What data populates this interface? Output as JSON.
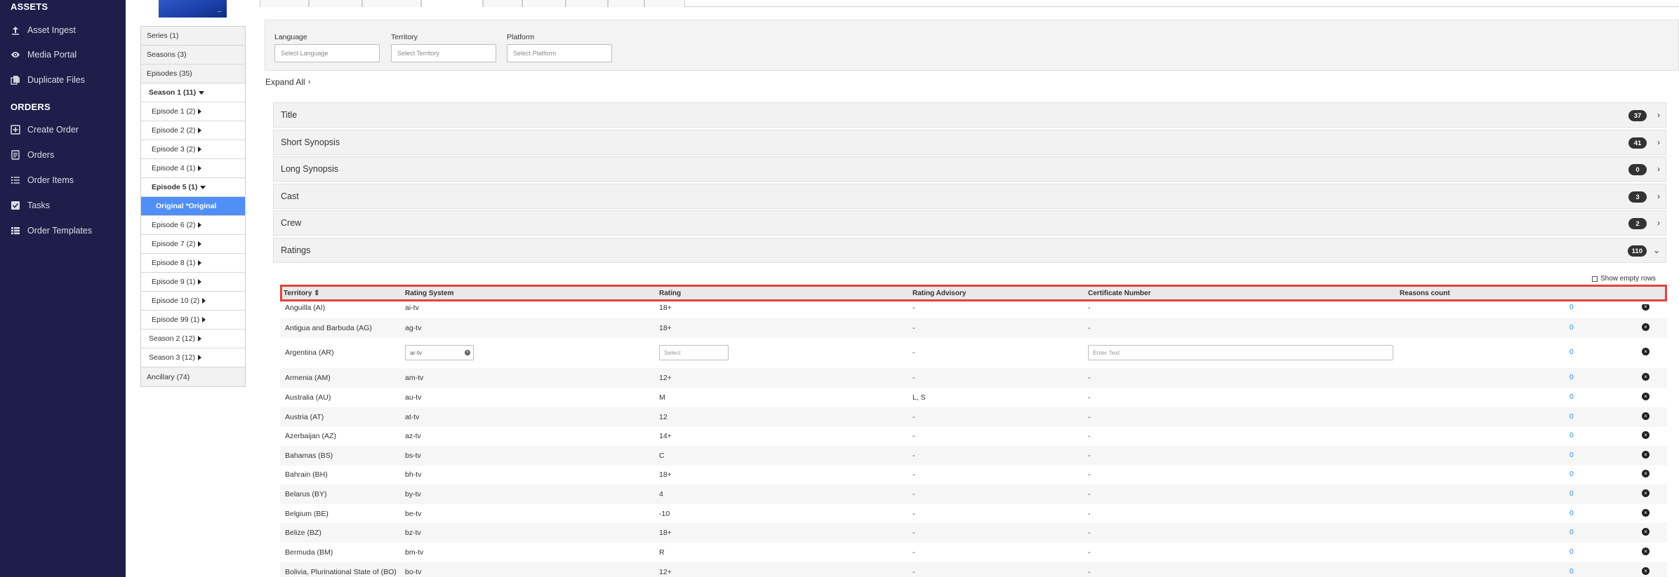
{
  "sidebar": {
    "assets_heading": "ASSETS",
    "assets_items": [
      {
        "label": "Asset Ingest",
        "icon": "upload-icon"
      },
      {
        "label": "Media Portal",
        "icon": "eye-icon"
      },
      {
        "label": "Duplicate Files",
        "icon": "files-icon"
      }
    ],
    "orders_heading": "ORDERS",
    "orders_items": [
      {
        "label": "Create Order",
        "icon": "plus-square-icon"
      },
      {
        "label": "Orders",
        "icon": "document-icon"
      },
      {
        "label": "Order Items",
        "icon": "list-icon"
      },
      {
        "label": "Tasks",
        "icon": "checkbox-icon"
      },
      {
        "label": "Order Templates",
        "icon": "table-icon"
      }
    ]
  },
  "thumbnail": {
    "tag": "←"
  },
  "tree": [
    {
      "label": "Series (1)",
      "level": 0,
      "caret": ""
    },
    {
      "label": "Seasons (3)",
      "level": 0,
      "caret": ""
    },
    {
      "label": "Episodes (35)",
      "level": 0,
      "caret": ""
    },
    {
      "label": "Season 1 (11)",
      "level": 1,
      "caret": "down",
      "bold": true
    },
    {
      "label": "Episode 1 (2)",
      "level": 2,
      "caret": "right"
    },
    {
      "label": "Episode 2 (2)",
      "level": 2,
      "caret": "right"
    },
    {
      "label": "Episode 3 (2)",
      "level": 2,
      "caret": "right"
    },
    {
      "label": "Episode 4 (1)",
      "level": 2,
      "caret": "right"
    },
    {
      "label": "Episode 5 (1)",
      "level": 2,
      "caret": "down",
      "bold": true
    },
    {
      "label": "Original *Original",
      "level": 3,
      "caret": ""
    },
    {
      "label": "Episode 6 (2)",
      "level": 2,
      "caret": "right"
    },
    {
      "label": "Episode 7 (2)",
      "level": 2,
      "caret": "right"
    },
    {
      "label": "Episode 8 (1)",
      "level": 2,
      "caret": "right"
    },
    {
      "label": "Episode 9 (1)",
      "level": 2,
      "caret": "right"
    },
    {
      "label": "Episode 10 (2)",
      "level": 2,
      "caret": "right"
    },
    {
      "label": "Episode 99 (1)",
      "level": 2,
      "caret": "right"
    },
    {
      "label": "Season 2 (12)",
      "level": 1,
      "caret": "right"
    },
    {
      "label": "Season 3 (12)",
      "level": 1,
      "caret": "right"
    },
    {
      "label": "Ancillary (74)",
      "level": 0,
      "caret": ""
    }
  ],
  "filters": {
    "language": {
      "label": "Language",
      "placeholder": "Select Language"
    },
    "territory": {
      "label": "Territory",
      "placeholder": "Select Territory"
    },
    "platform": {
      "label": "Platform",
      "placeholder": "Select Platform"
    }
  },
  "expand_all": "Expand All",
  "sections": [
    {
      "label": "Title",
      "count": "37",
      "chevron": "›"
    },
    {
      "label": "Short Synopsis",
      "count": "41",
      "chevron": "›"
    },
    {
      "label": "Long Synopsis",
      "count": "0",
      "chevron": "›"
    },
    {
      "label": "Cast",
      "count": "3",
      "chevron": "›"
    },
    {
      "label": "Crew",
      "count": "2",
      "chevron": "›"
    },
    {
      "label": "Ratings",
      "count": "110",
      "chevron": "⌄"
    }
  ],
  "show_empty_rows": "Show empty rows",
  "ratings_table": {
    "headers": [
      "Territory ⇕",
      "Rating System",
      "Rating",
      "Rating Advisory",
      "Certificate Number",
      "Reasons count"
    ],
    "rows": [
      {
        "territory": "Anguilla (AI)",
        "system": "ai-tv",
        "rating": "18+",
        "advisory": "-",
        "certificate": "-",
        "count": "0"
      },
      {
        "territory": "Antigua and Barbuda (AG)",
        "system": "ag-tv",
        "rating": "18+",
        "advisory": "-",
        "certificate": "-",
        "count": "0"
      },
      {
        "territory": "Argentina (AR)",
        "system": "ar-tv",
        "rating": "",
        "rating_placeholder": "Select",
        "advisory": "-",
        "certificate": "",
        "certificate_placeholder": "Enter Text",
        "count": "0",
        "editing": true
      },
      {
        "territory": "Armenia (AM)",
        "system": "am-tv",
        "rating": "12+",
        "advisory": "-",
        "certificate": "-",
        "count": "0"
      },
      {
        "territory": "Australia (AU)",
        "system": "au-tv",
        "rating": "M",
        "advisory": "L, S",
        "certificate": "-",
        "count": "0"
      },
      {
        "territory": "Austria (AT)",
        "system": "at-tv",
        "rating": "12",
        "advisory": "-",
        "certificate": "-",
        "count": "0"
      },
      {
        "territory": "Azerbaijan (AZ)",
        "system": "az-tv",
        "rating": "14+",
        "advisory": "-",
        "certificate": "-",
        "count": "0"
      },
      {
        "territory": "Bahamas (BS)",
        "system": "bs-tv",
        "rating": "C",
        "advisory": "-",
        "certificate": "-",
        "count": "0"
      },
      {
        "territory": "Bahrain (BH)",
        "system": "bh-tv",
        "rating": "18+",
        "advisory": "-",
        "certificate": "-",
        "count": "0"
      },
      {
        "territory": "Belarus (BY)",
        "system": "by-tv",
        "rating": "4",
        "advisory": "-",
        "certificate": "-",
        "count": "0"
      },
      {
        "territory": "Belgium (BE)",
        "system": "be-tv",
        "rating": "-10",
        "advisory": "-",
        "certificate": "-",
        "count": "0"
      },
      {
        "territory": "Belize (BZ)",
        "system": "bz-tv",
        "rating": "18+",
        "advisory": "-",
        "certificate": "-",
        "count": "0"
      },
      {
        "territory": "Bermuda (BM)",
        "system": "bm-tv",
        "rating": "R",
        "advisory": "-",
        "certificate": "-",
        "count": "0"
      },
      {
        "territory": "Bolivia, Plurinational State of (BO)",
        "system": "bo-tv",
        "rating": "12+",
        "advisory": "-",
        "certificate": "-",
        "count": "0"
      }
    ]
  },
  "colors": {
    "sidebar_bg": "#1f1e4a",
    "selected": "#4f8ff6",
    "highlight_border": "#e0443e",
    "link": "#2b8fe0"
  }
}
